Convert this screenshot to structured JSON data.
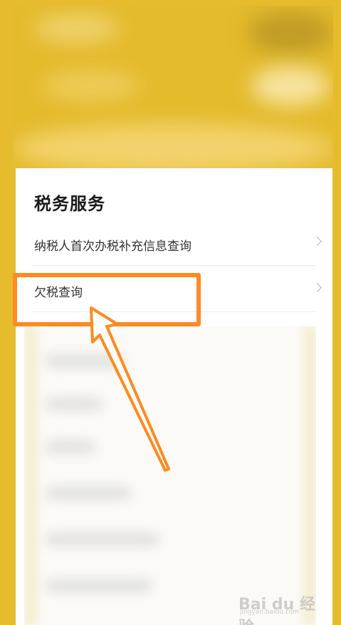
{
  "section": {
    "title": "税务服务"
  },
  "items": [
    {
      "label": "纳税人首次办税补充信息查询",
      "icon": "chevron-right-icon"
    },
    {
      "label": "欠税查询",
      "icon": "chevron-right-icon"
    }
  ],
  "annotation": {
    "color": "#ff8a1f",
    "highlighted_item": "欠税查询"
  },
  "watermark": {
    "text": "Bai du 经验",
    "sub": "jingyan.baidu.com"
  },
  "colors": {
    "background": "#e6bc2e",
    "card": "#ffffff"
  }
}
